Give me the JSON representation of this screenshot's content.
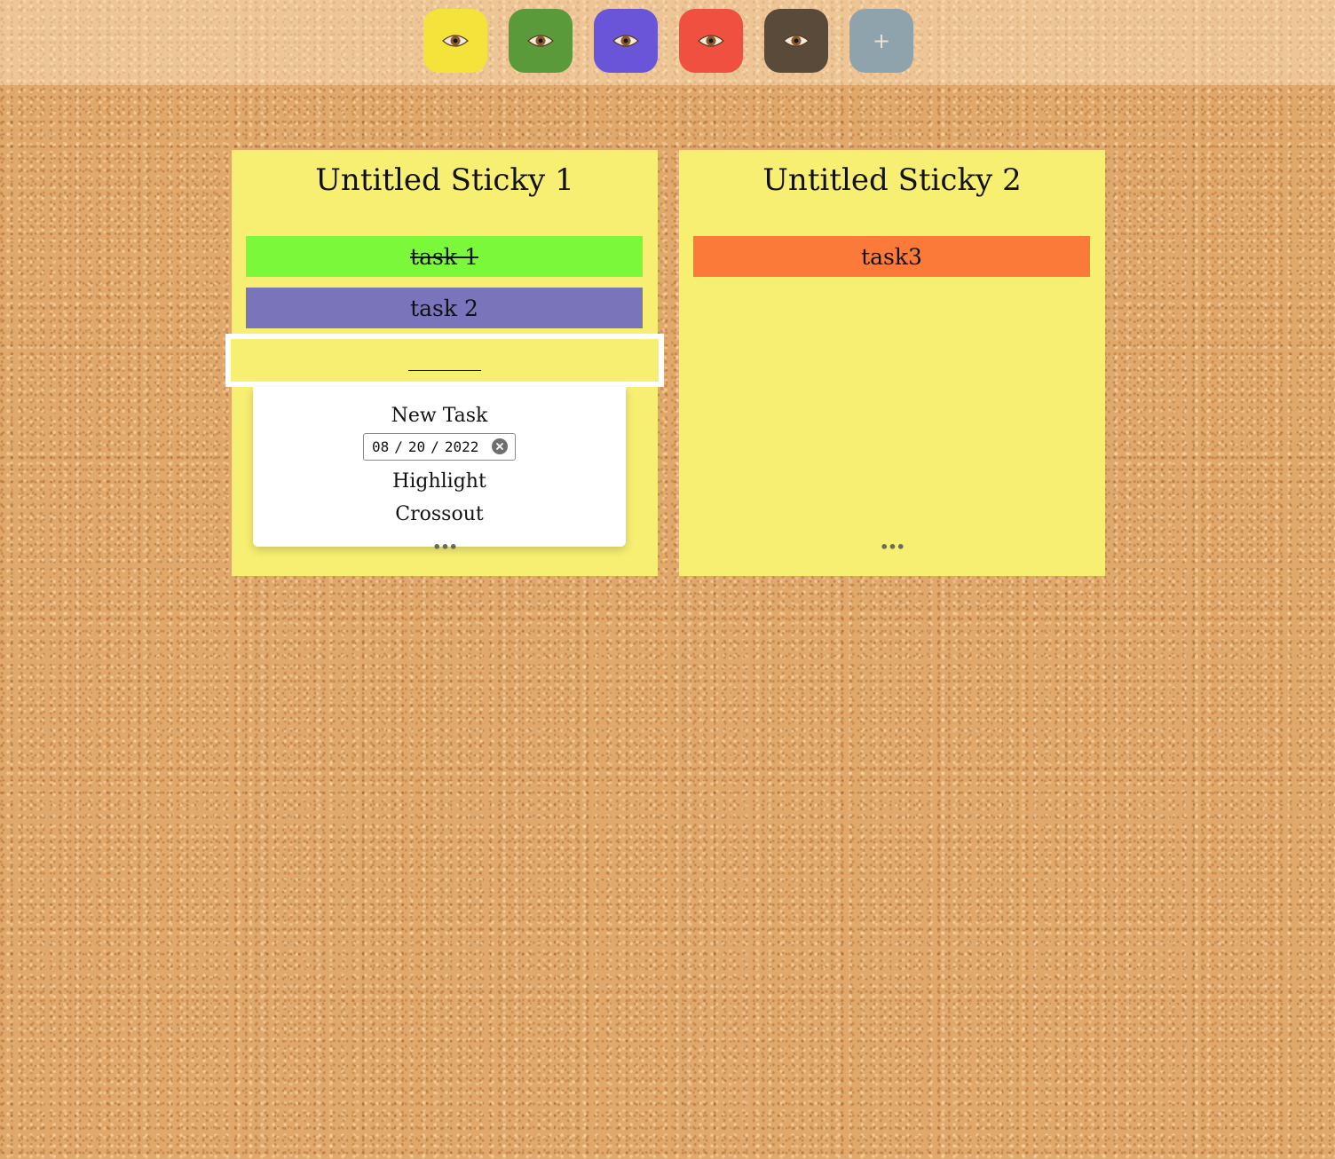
{
  "toolbar": {
    "tabs": [
      {
        "icon": "eye-icon",
        "color": "#f3e33a"
      },
      {
        "icon": "eye-icon",
        "color": "#5a9a3a"
      },
      {
        "icon": "eye-icon",
        "color": "#6a55d8"
      },
      {
        "icon": "eye-icon",
        "color": "#f05040"
      },
      {
        "icon": "eye-icon",
        "color": "#5a4a3a"
      }
    ],
    "add_button": {
      "label": "+",
      "icon": "plus-icon",
      "color": "#8fa3ad"
    }
  },
  "stickies": [
    {
      "title": "Untitled Sticky 1",
      "color": "#f7ef72",
      "tasks": [
        {
          "text": "task 1",
          "color": "#7cf83a",
          "crossed": true
        },
        {
          "text": "task 2",
          "color": "#7a74bb",
          "crossed": false
        }
      ],
      "new_task_input_value": "",
      "menu": {
        "new_task_label": "New Task",
        "date": {
          "month": "08",
          "day": "20",
          "year": "2022",
          "separator": "/"
        },
        "highlight_label": "Highlight",
        "crossout_label": "Crossout"
      },
      "more_label": "•••"
    },
    {
      "title": "Untitled Sticky 2",
      "color": "#f7ef72",
      "tasks": [
        {
          "text": "task3",
          "color": "#fb7a3a",
          "crossed": false
        }
      ],
      "more_label": "•••"
    }
  ]
}
